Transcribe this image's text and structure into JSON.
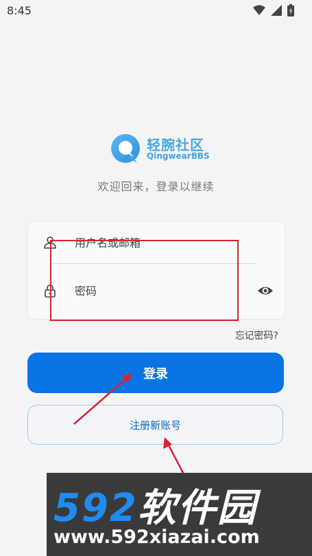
{
  "status_bar": {
    "time": "8:45"
  },
  "logo": {
    "title": "轻腕社区",
    "subtitle": "QingwearBBS"
  },
  "welcome_text": "欢迎回来，登录以继续",
  "form": {
    "username_placeholder": "用户名或邮箱",
    "password_placeholder": "密码",
    "forgot_password": "忘记密码?",
    "login_label": "登录",
    "register_label": "注册新账号"
  },
  "watermark": {
    "prefix": "592",
    "suffix": "软件园",
    "url": "www.592xiazai.com"
  },
  "colors": {
    "primary": "#0a74e5",
    "brand": "#46a9ea",
    "register_border": "#9bc7ef",
    "annotation": "#d9232e",
    "background": "#f4f4f6"
  },
  "icons": [
    "wifi-icon",
    "signal-icon",
    "battery-icon",
    "user-icon",
    "lock-icon",
    "eye-icon"
  ]
}
